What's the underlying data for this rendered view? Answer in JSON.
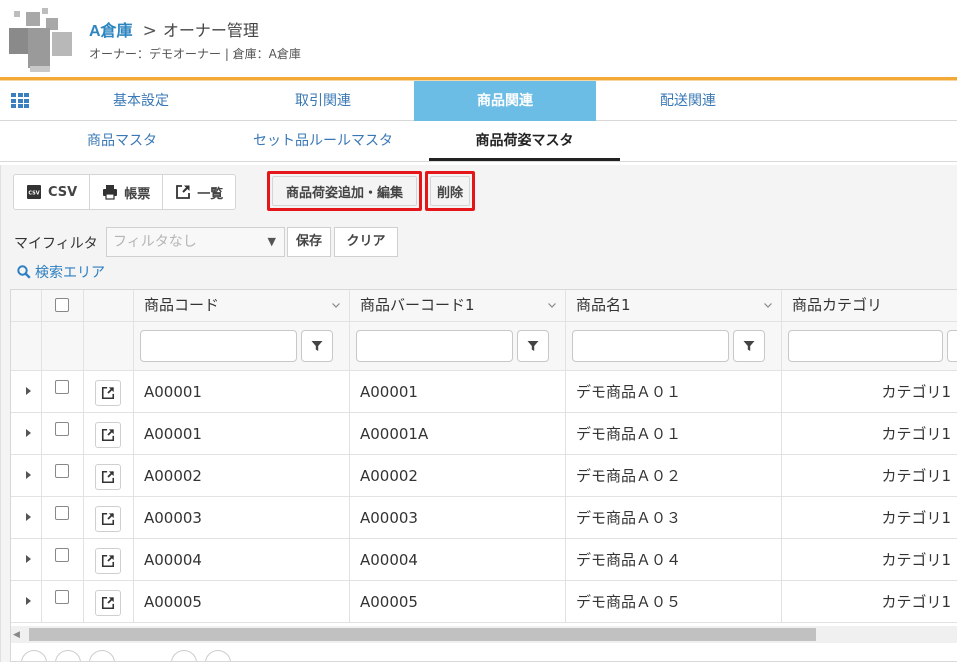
{
  "header": {
    "warehouse": "A倉庫",
    "separator": ">",
    "page_title": "オーナー管理",
    "subtitle": "オーナー：デモオーナー | 倉庫：A倉庫"
  },
  "main_tabs": [
    {
      "label": "基本設定",
      "active": false
    },
    {
      "label": "取引関連",
      "active": false
    },
    {
      "label": "商品関連",
      "active": true
    },
    {
      "label": "配送関連",
      "active": false
    }
  ],
  "sub_tabs": [
    {
      "label": "商品マスタ",
      "active": false
    },
    {
      "label": "セット品ルールマスタ",
      "active": false
    },
    {
      "label": "商品荷姿マスタ",
      "active": true
    }
  ],
  "toolbar": {
    "csv_label": "CSV",
    "csv_icon_text": "CSV",
    "print_label": "帳票",
    "list_label": "一覧",
    "add_edit_label": "商品荷姿追加・編集",
    "delete_label": "削除"
  },
  "filter": {
    "label": "マイフィルタ",
    "selected": "フィルタなし",
    "save_label": "保存",
    "clear_label": "クリア",
    "search_area_label": "検索エリア"
  },
  "grid": {
    "columns": [
      "商品コード",
      "商品バーコード1",
      "商品名1",
      "商品カテゴリ"
    ],
    "rows": [
      {
        "code": "A00001",
        "barcode": "A00001",
        "name": "デモ商品Ａ０１",
        "category": "カテゴリ1"
      },
      {
        "code": "A00001",
        "barcode": "A00001A",
        "name": "デモ商品Ａ０１",
        "category": "カテゴリ1"
      },
      {
        "code": "A00002",
        "barcode": "A00002",
        "name": "デモ商品Ａ０２",
        "category": "カテゴリ1"
      },
      {
        "code": "A00003",
        "barcode": "A00003",
        "name": "デモ商品Ａ０３",
        "category": "カテゴリ1"
      },
      {
        "code": "A00004",
        "barcode": "A00004",
        "name": "デモ商品Ａ０４",
        "category": "カテゴリ1"
      },
      {
        "code": "A00005",
        "barcode": "A00005",
        "name": "デモ商品Ａ０５",
        "category": "カテゴリ1"
      }
    ]
  },
  "colors": {
    "accent": "#f3a935",
    "active_tab": "#6cbde6",
    "link": "#2e86c1",
    "highlight": "#e4161a"
  }
}
